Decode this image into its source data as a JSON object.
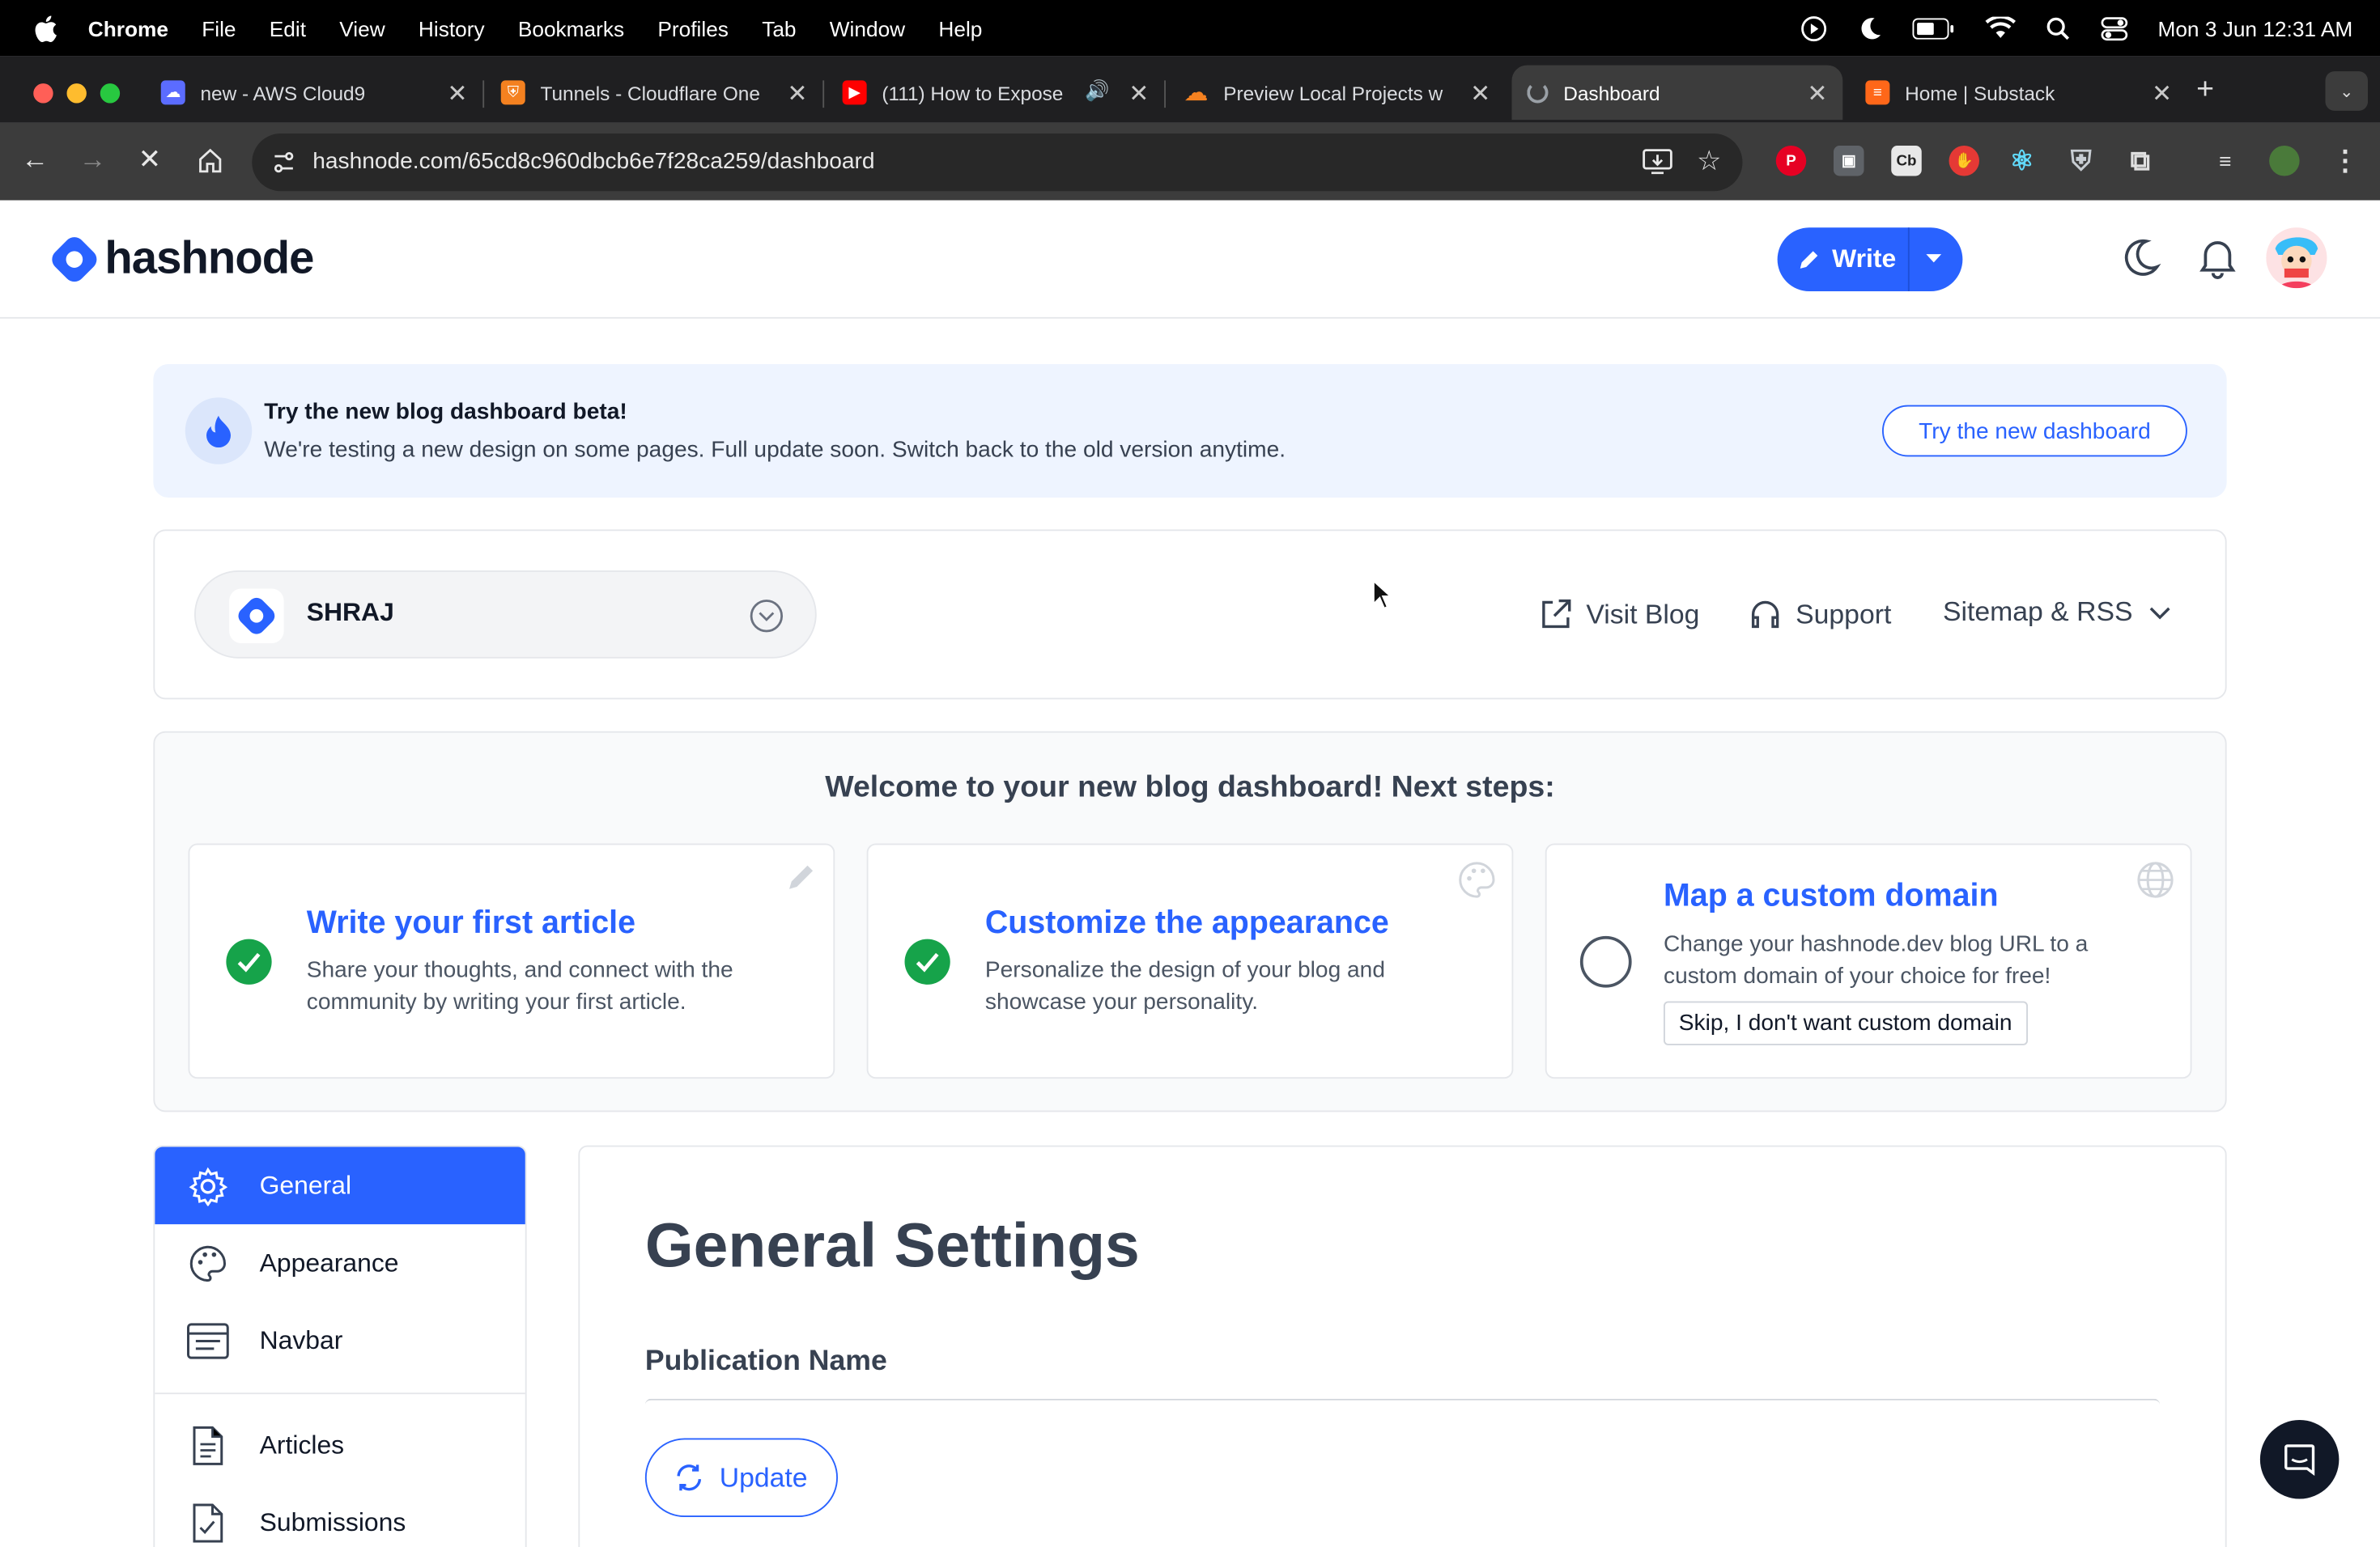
{
  "menubar": {
    "app": "Chrome",
    "items": [
      "File",
      "Edit",
      "View",
      "History",
      "Bookmarks",
      "Profiles",
      "Tab",
      "Window",
      "Help"
    ],
    "clock": "Mon 3 Jun  12:31 AM"
  },
  "tabs": [
    {
      "title": "new - AWS Cloud9",
      "favicon_color": "#5b6cff"
    },
    {
      "title": "Tunnels - Cloudflare One",
      "favicon_color": "#f48120"
    },
    {
      "title": "(111) How to Expose",
      "favicon_color": "#ff0000"
    },
    {
      "title": "Preview Local Projects w",
      "favicon_color": "#f48120"
    },
    {
      "title": "Dashboard",
      "favicon_color": "#9aa0a6"
    },
    {
      "title": "Home | Substack",
      "favicon_color": "#ff6719"
    }
  ],
  "browser": {
    "url": "hashnode.com/65cd8c960dbcb6e7f28ca259/dashboard",
    "extensions": [
      {
        "icon": "pinterest-icon",
        "label": "P",
        "color": "#e60023"
      },
      {
        "icon": "reader-icon",
        "label": "▣",
        "color": "#5f6368"
      },
      {
        "icon": "cb-icon",
        "label": "Cb",
        "color": "#e8e8e8"
      },
      {
        "icon": "hand-icon",
        "label": "✋",
        "color": "#e53935"
      },
      {
        "icon": "react-icon",
        "label": "⚛",
        "color": "#61dafb"
      },
      {
        "icon": "shield-icon",
        "label": "⛨",
        "color": "#9aa0a6"
      },
      {
        "icon": "puzzle-icon",
        "label": "⧉",
        "color": "#e0e0e0"
      }
    ]
  },
  "header": {
    "brand": "hashnode",
    "write_label": "Write"
  },
  "banner": {
    "title": "Try the new blog dashboard beta!",
    "text": "We're testing a new design on some pages. Full update soon. Switch back to the old version anytime.",
    "button": "Try the new dashboard"
  },
  "blogbar": {
    "blog_name": "SHRAJ",
    "visit": "Visit Blog",
    "support": "Support",
    "sitemap": "Sitemap & RSS"
  },
  "steps": {
    "heading": "Welcome to your new blog dashboard! Next steps:",
    "cards": [
      {
        "title": "Write your first article",
        "desc": "Share your thoughts, and connect with the community by writing your first article.",
        "done": true
      },
      {
        "title": "Customize the appearance",
        "desc": "Personalize the design of your blog and showcase your personality.",
        "done": true
      },
      {
        "title": "Map a custom domain",
        "desc": "Change your hashnode.dev blog URL to a custom domain of your choice for free!",
        "done": false,
        "skip": "Skip, I don't want custom domain"
      }
    ]
  },
  "sidebar": {
    "items": [
      {
        "label": "General",
        "icon": "gear-icon",
        "active": true
      },
      {
        "label": "Appearance",
        "icon": "palette-icon"
      },
      {
        "label": "Navbar",
        "icon": "navbar-icon"
      },
      {
        "label": "Articles",
        "icon": "document-icon"
      },
      {
        "label": "Submissions",
        "icon": "submissions-icon"
      }
    ]
  },
  "main": {
    "title": "General Settings",
    "field_label": "Publication Name",
    "update_label": "Update"
  },
  "colors": {
    "brand": "#2962ff",
    "success": "#16a34a"
  }
}
